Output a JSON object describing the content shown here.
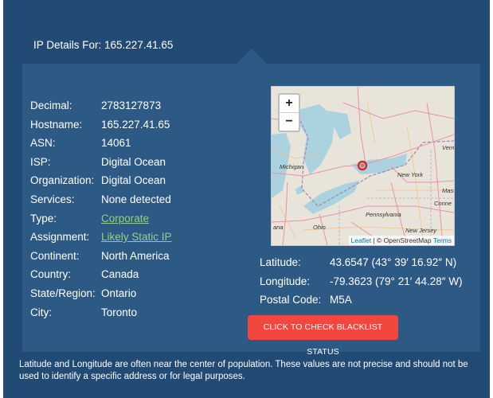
{
  "header": {
    "title": "IP Details For: 165.227.41.65"
  },
  "details": [
    {
      "label": "Decimal:",
      "value": "2783127873",
      "link": false
    },
    {
      "label": "Hostname:",
      "value": "165.227.41.65",
      "link": false
    },
    {
      "label": "ASN:",
      "value": "14061",
      "link": false
    },
    {
      "label": "ISP:",
      "value": "Digital Ocean",
      "link": false
    },
    {
      "label": "Organization:",
      "value": "Digital Ocean",
      "link": false
    },
    {
      "label": "Services:",
      "value": "None detected",
      "link": false
    },
    {
      "label": "Type:",
      "value": "Corporate",
      "link": true
    },
    {
      "label": "Assignment:",
      "value": "Likely Static IP",
      "link": true
    },
    {
      "label": "Continent:",
      "value": "North America",
      "link": false
    },
    {
      "label": "Country:",
      "value": "Canada",
      "link": false
    },
    {
      "label": "State/Region:",
      "value": "Ontario",
      "link": false
    },
    {
      "label": "City:",
      "value": "Toronto",
      "link": false
    }
  ],
  "map": {
    "zoom_in": "+",
    "zoom_out": "−",
    "attribution_leaflet": "Leaflet",
    "attribution_sep": " | © ",
    "attribution_osm": "OpenStreetMap",
    "attribution_terms": "Terms",
    "labels": {
      "michigan": "Michigan",
      "new_york": "New York",
      "pennsylvania": "Pennsylvania",
      "ohio": "Ohio",
      "new_jersey": "New Jersey",
      "verm": "Verm",
      "mass": "Mass",
      "conn": "Conne",
      "ana": "ana"
    },
    "marker_color": "#d7262c"
  },
  "geo": [
    {
      "label": "Latitude:",
      "value": "43.6547  (43° 39′ 16.92″ N)"
    },
    {
      "label": "Longitude:",
      "value": "-79.3623  (79° 21′ 44.28″ W)"
    },
    {
      "label": "Postal Code:",
      "value": "M5A"
    }
  ],
  "button": {
    "label": "CLICK TO CHECK BLACKLIST STATUS"
  },
  "note": "Latitude and Longitude are often near the center of population. These values are not precise and should not be used to identify a specific address or for legal purposes."
}
